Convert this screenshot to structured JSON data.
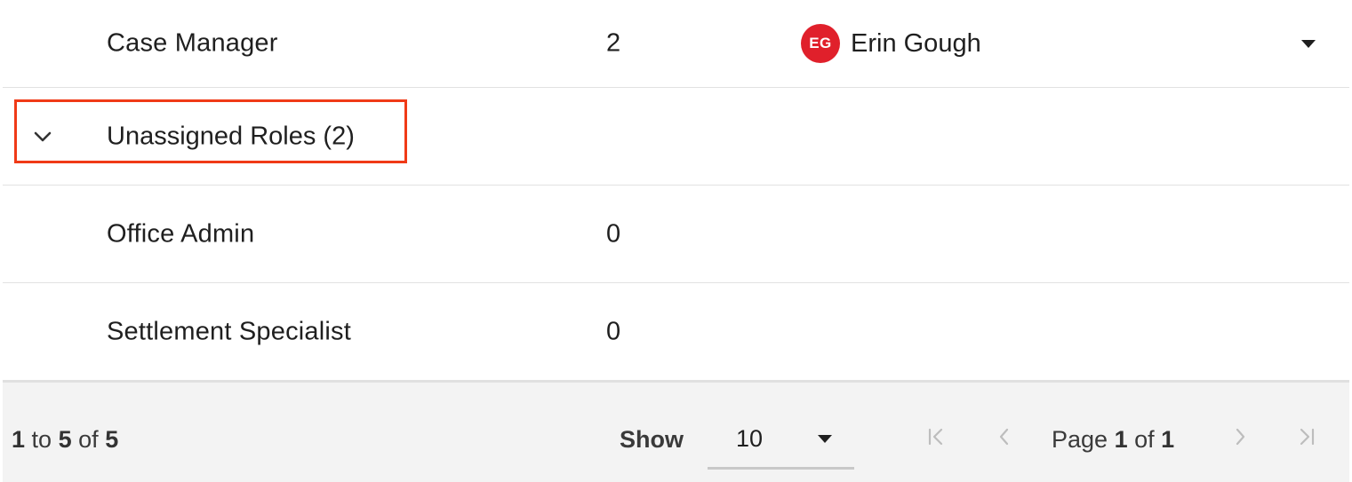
{
  "rows": [
    {
      "role": "Case Manager",
      "count": "2",
      "assignee": {
        "initials": "EG",
        "name": "Erin Gough",
        "avatar_color": "#e0202b"
      }
    }
  ],
  "group": {
    "label": "Unassigned Roles",
    "count_text": "(2)"
  },
  "group_rows": [
    {
      "role": "Office Admin",
      "count": "0"
    },
    {
      "role": "Settlement Specialist",
      "count": "0"
    }
  ],
  "footer": {
    "range_start": "1",
    "range_to": "to",
    "range_end": "5",
    "range_of": "of",
    "range_total": "5",
    "show_label": "Show",
    "page_size": "10",
    "page_label": "Page",
    "page_current": "1",
    "page_of": "of",
    "page_total": "1"
  },
  "icons": {
    "row_dropdown": "caret-down-icon",
    "group_toggle": "chevron-down-icon",
    "first_page": "first-page-icon",
    "prev_page": "chevron-left-icon",
    "next_page": "chevron-right-icon",
    "last_page": "last-page-icon"
  },
  "colors": {
    "highlight": "#f03a17",
    "avatar": "#e0202b",
    "footer_bg": "#f3f3f3"
  }
}
